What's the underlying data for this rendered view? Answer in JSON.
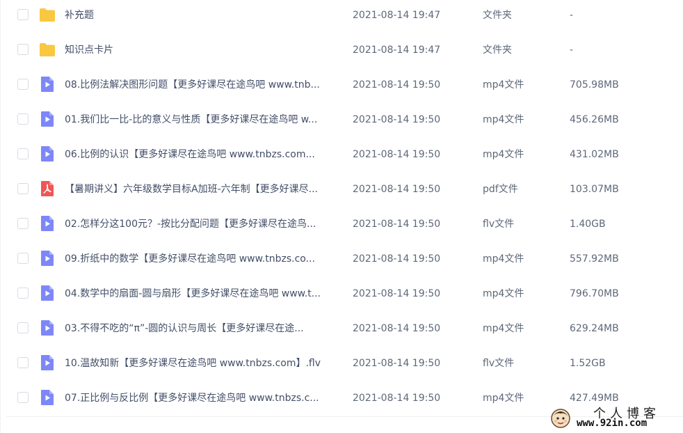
{
  "colors": {
    "folder": "#f9c740",
    "video": "#7e87f8",
    "pdf": "#ef5757",
    "text": "#424e67"
  },
  "files": [
    {
      "name": "补充题",
      "date": "2021-08-14 19:47",
      "type": "文件夹",
      "size": "-",
      "icon": "folder-icon"
    },
    {
      "name": "知识点卡片",
      "date": "2021-08-14 19:47",
      "type": "文件夹",
      "size": "-",
      "icon": "folder-icon"
    },
    {
      "name": "08.比例法解决图形问题【更多好课尽在途鸟吧 www.tnb...",
      "date": "2021-08-14 19:50",
      "type": "mp4文件",
      "size": "705.98MB",
      "icon": "video-file-icon"
    },
    {
      "name": "01.我们比一比-比的意义与性质【更多好课尽在途鸟吧 w...",
      "date": "2021-08-14 19:50",
      "type": "mp4文件",
      "size": "456.26MB",
      "icon": "video-file-icon"
    },
    {
      "name": "06.比例的认识【更多好课尽在途鸟吧 www.tnbzs.com...",
      "date": "2021-08-14 19:50",
      "type": "mp4文件",
      "size": "431.02MB",
      "icon": "video-file-icon"
    },
    {
      "name": "【暑期讲义】六年级数学目标A加班-六年制【更多好课尽...",
      "date": "2021-08-14 19:50",
      "type": "pdf文件",
      "size": "103.07MB",
      "icon": "pdf-file-icon"
    },
    {
      "name": "02.怎样分这100元？-按比分配问题【更多好课尽在途鸟...",
      "date": "2021-08-14 19:50",
      "type": "flv文件",
      "size": "1.40GB",
      "icon": "video-file-icon"
    },
    {
      "name": "09.折纸中的数学【更多好课尽在途鸟吧 www.tnbzs.co...",
      "date": "2021-08-14 19:50",
      "type": "mp4文件",
      "size": "557.92MB",
      "icon": "video-file-icon"
    },
    {
      "name": "04.数学中的扇面-圆与扇形【更多好课尽在途鸟吧 www.t...",
      "date": "2021-08-14 19:50",
      "type": "mp4文件",
      "size": "796.70MB",
      "icon": "video-file-icon"
    },
    {
      "name": "03.不得不吃的“π”-圆的认识与周长【更多好课尽在途...",
      "date": "2021-08-14 19:50",
      "type": "mp4文件",
      "size": "629.24MB",
      "icon": "video-file-icon"
    },
    {
      "name": "10.温故知新【更多好课尽在途鸟吧 www.tnbzs.com】.flv",
      "date": "2021-08-14 19:50",
      "type": "flv文件",
      "size": "1.52GB",
      "icon": "video-file-icon"
    },
    {
      "name": "07.正比例与反比例【更多好课尽在途鸟吧 www.tnbzs.c...",
      "date": "2021-08-14 19:50",
      "type": "mp4文件",
      "size": "427.49MB",
      "icon": "video-file-icon"
    }
  ],
  "watermark": {
    "title": "个人博客",
    "url": "www.92in.com"
  }
}
